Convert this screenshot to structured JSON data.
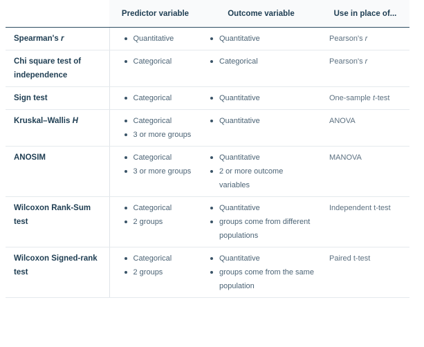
{
  "table": {
    "headers": {
      "method": "",
      "predictor": "Predictor variable",
      "outcome": "Outcome variable",
      "use_instead": "Use in place of..."
    },
    "rows": [
      {
        "method": "Spearman's ",
        "method_italic": "r",
        "predictor": [
          "Quantitative"
        ],
        "outcome": [
          "Quantitative"
        ],
        "use_instead": "Pearson's ",
        "use_instead_italic": "r"
      },
      {
        "method": "Chi square test of independence",
        "method_italic": "",
        "predictor": [
          "Categorical"
        ],
        "outcome": [
          "Categorical"
        ],
        "use_instead": "Pearson's ",
        "use_instead_italic": "r"
      },
      {
        "method": "Sign test",
        "method_italic": "",
        "predictor": [
          "Categorical"
        ],
        "outcome": [
          "Quantitative"
        ],
        "use_instead": "One-sample ",
        "use_instead_italic": "t",
        "use_instead_suffix": "-test"
      },
      {
        "method": "Kruskal–Wallis ",
        "method_italic": "H",
        "predictor": [
          "Categorical",
          "3 or more groups"
        ],
        "outcome": [
          "Quantitative"
        ],
        "use_instead": "ANOVA",
        "use_instead_italic": ""
      },
      {
        "method": "ANOSIM",
        "method_italic": "",
        "predictor": [
          "Categorical",
          "3 or more groups"
        ],
        "outcome": [
          "Quantitative",
          "2 or more outcome variables"
        ],
        "use_instead": "MANOVA",
        "use_instead_italic": ""
      },
      {
        "method": "Wilcoxon Rank-Sum test",
        "method_italic": "",
        "predictor": [
          "Categorical",
          "2 groups"
        ],
        "outcome": [
          "Quantitative",
          "groups come from different populations"
        ],
        "use_instead": "Independent t-test",
        "use_instead_italic": ""
      },
      {
        "method": "Wilcoxon Signed-rank test",
        "method_italic": "",
        "predictor": [
          "Categorical",
          "2 groups"
        ],
        "outcome": [
          "Quantitative",
          "groups come from the same population"
        ],
        "use_instead": "Paired t-test",
        "use_instead_italic": ""
      }
    ]
  }
}
